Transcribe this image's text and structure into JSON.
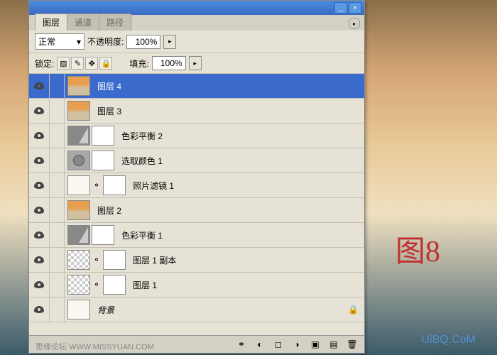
{
  "tabs": {
    "layers": "图层",
    "channels": "通道",
    "paths": "路径"
  },
  "opts": {
    "blendmode": "正常",
    "opacity_label": "不透明度:",
    "opacity": "100%",
    "lock_label": "锁定:",
    "fill_label": "填充:",
    "fill": "100%"
  },
  "layers": [
    {
      "selected": true,
      "name": "图层 4",
      "type": "sunset"
    },
    {
      "name": "图层 3",
      "type": "sunset"
    },
    {
      "name": "色彩平衡 2",
      "type": "adj",
      "mask": true
    },
    {
      "name": "选取颜色 1",
      "type": "circle",
      "mask": true
    },
    {
      "name": "照片滤镜 1",
      "type": "photo",
      "mask": true,
      "linkmask": true
    },
    {
      "name": "图层 2",
      "type": "sunset"
    },
    {
      "name": "色彩平衡 1",
      "type": "adj",
      "mask": true
    },
    {
      "name": "图层 1 副本",
      "type": "checker",
      "mask": true,
      "linkmask": true
    },
    {
      "name": "图层 1",
      "type": "checker",
      "mask": true,
      "linkmask": true
    },
    {
      "name": "背景",
      "type": "photo",
      "italic": true,
      "locked": true
    }
  ],
  "figlabel": "图8",
  "watermark": "UiBQ.CoM",
  "credit": "思缘论坛   WWW.MISSYUAN.COM",
  "chart_data": null
}
